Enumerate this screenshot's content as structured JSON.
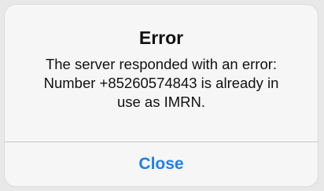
{
  "alert": {
    "title": "Error",
    "message_lines": [
      "The server responded with an error:",
      "Number +85260574843 is already in",
      "use as IMRN."
    ],
    "close_label": "Close"
  },
  "colors": {
    "accent": "#1c7ff2",
    "alert_background": "#f6f6f6",
    "divider": "#c8c8cc"
  }
}
